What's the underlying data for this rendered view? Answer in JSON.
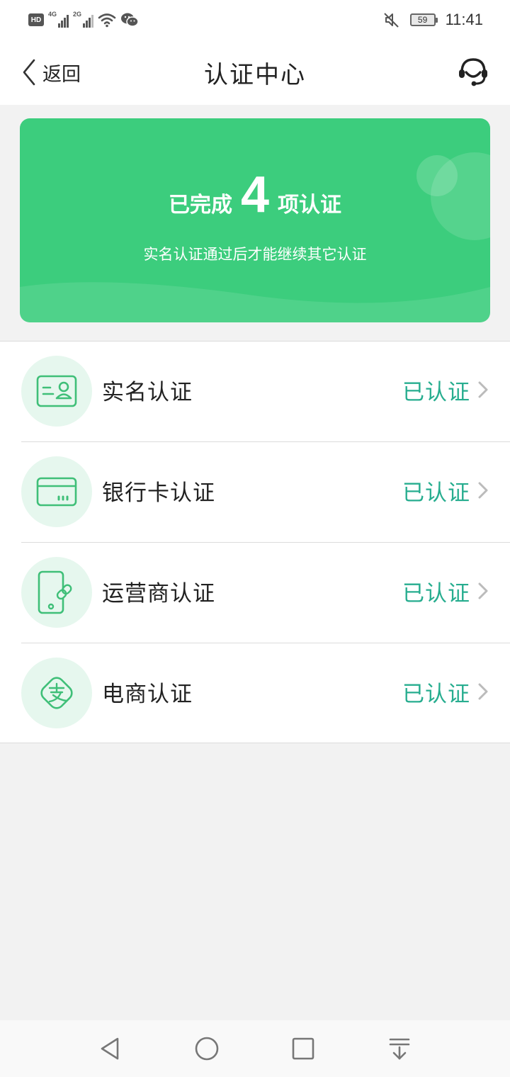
{
  "status_bar": {
    "left_icons": [
      "hd-icon",
      "signal-4g-icon",
      "signal-2g-icon",
      "wifi-icon",
      "wechat-icon"
    ],
    "net1_label": "4G",
    "net2_label": "2G",
    "battery": "59",
    "time": "11:41"
  },
  "nav": {
    "back_label": "返回",
    "title": "认证中心",
    "service_icon": "customer-service-icon"
  },
  "banner": {
    "prefix": "已完成",
    "count": "4",
    "suffix": "项认证",
    "subtitle": "实名认证通过后才能继续其它认证"
  },
  "items": [
    {
      "label": "实名认证",
      "status": "已认证",
      "icon": "id-card-icon"
    },
    {
      "label": "银行卡认证",
      "status": "已认证",
      "icon": "bank-card-icon"
    },
    {
      "label": "运营商认证",
      "status": "已认证",
      "icon": "phone-link-icon"
    },
    {
      "label": "电商认证",
      "status": "已认证",
      "icon": "alipay-icon"
    }
  ],
  "colors": {
    "brand_green": "#3ccd7d",
    "status_teal": "#27ad8f",
    "icon_bg": "#e6f7ee",
    "icon_stroke": "#3fbf78"
  },
  "system_nav": [
    "back-triangle-icon",
    "home-circle-icon",
    "recents-square-icon",
    "notification-pull-icon"
  ]
}
